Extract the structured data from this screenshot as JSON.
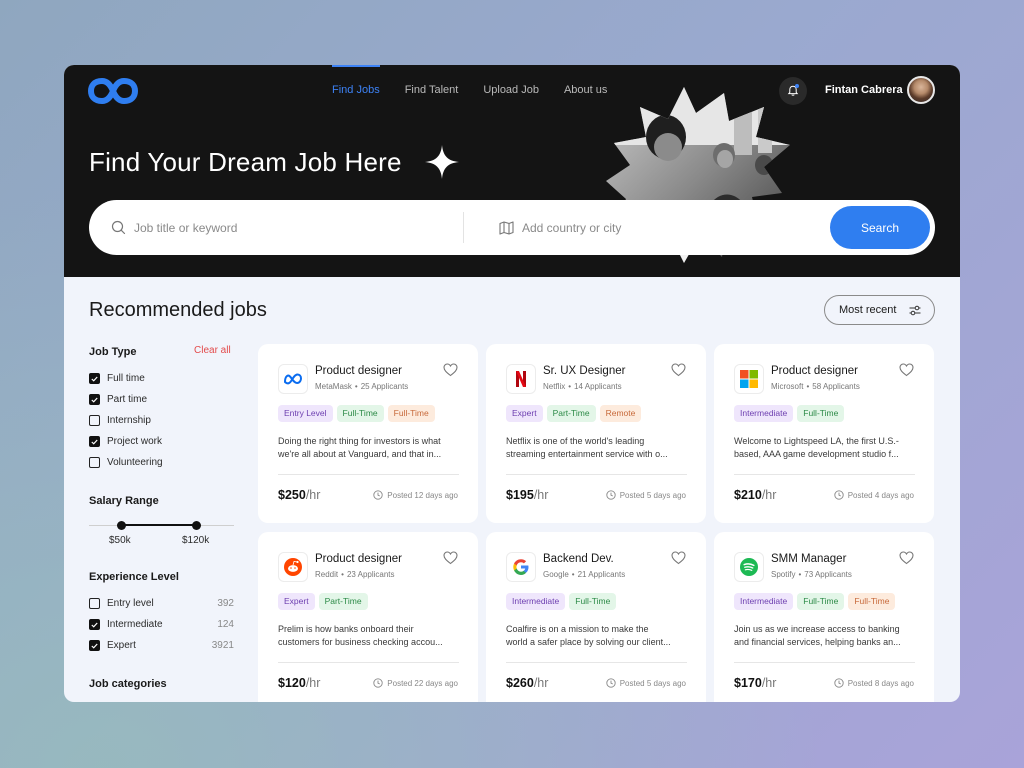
{
  "nav": {
    "items": [
      {
        "label": "Find Jobs",
        "active": true
      },
      {
        "label": "Find Talent",
        "active": false
      },
      {
        "label": "Upload Job",
        "active": false
      },
      {
        "label": "About us",
        "active": false
      }
    ],
    "user_name": "Fintan Cabrera"
  },
  "hero": {
    "title": "Find Your Dream Job Here",
    "search": {
      "keyword_placeholder": "Job title or keyword",
      "location_placeholder": "Add country or city",
      "button_label": "Search"
    }
  },
  "main": {
    "section_title": "Recommended jobs",
    "sort_label": "Most recent"
  },
  "filters": {
    "job_type": {
      "title": "Job Type",
      "clear_label": "Clear all",
      "options": [
        {
          "label": "Full time",
          "checked": true
        },
        {
          "label": "Part time",
          "checked": true
        },
        {
          "label": "Internship",
          "checked": false
        },
        {
          "label": "Project work",
          "checked": true
        },
        {
          "label": "Volunteering",
          "checked": false
        }
      ]
    },
    "salary": {
      "title": "Salary Range",
      "min_label": "$50k",
      "max_label": "$120k"
    },
    "experience": {
      "title": "Experience Level",
      "options": [
        {
          "label": "Entry level",
          "count": "392",
          "checked": false
        },
        {
          "label": "Intermediate",
          "count": "124",
          "checked": true
        },
        {
          "label": "Expert",
          "count": "3921",
          "checked": true
        }
      ]
    },
    "categories": {
      "title": "Job categories"
    }
  },
  "jobs": [
    {
      "title": "Product designer",
      "company": "MetaMask",
      "applicants": "25 Applicants",
      "logo": "meta-logo",
      "tags": [
        {
          "label": "Entry Level",
          "color": "purple"
        },
        {
          "label": "Full-Time",
          "color": "green"
        },
        {
          "label": "Full-Time",
          "color": "orange"
        }
      ],
      "desc1": "Doing the right thing for investors is what",
      "desc2": "we're all about at Vanguard, and that in...",
      "price": "$250",
      "unit": "/hr",
      "posted": "Posted 12 days ago"
    },
    {
      "title": "Sr. UX Designer",
      "company": "Netflix",
      "applicants": "14 Applicants",
      "logo": "netflix-logo",
      "tags": [
        {
          "label": "Expert",
          "color": "purple"
        },
        {
          "label": "Part-Time",
          "color": "green"
        },
        {
          "label": "Remote",
          "color": "orange"
        }
      ],
      "desc1": "Netflix is one of the world's leading",
      "desc2": "streaming entertainment service with o...",
      "price": "$195",
      "unit": "/hr",
      "posted": "Posted 5 days ago"
    },
    {
      "title": "Product designer",
      "company": "Microsoft",
      "applicants": "58 Applicants",
      "logo": "microsoft-logo",
      "tags": [
        {
          "label": "Intermediate",
          "color": "purple"
        },
        {
          "label": "Full-Time",
          "color": "green"
        }
      ],
      "desc1": "Welcome to Lightspeed LA, the first U.S.-",
      "desc2": "based, AAA game development studio f...",
      "price": "$210",
      "unit": "/hr",
      "posted": "Posted 4 days ago"
    },
    {
      "title": "Product designer",
      "company": "Reddit",
      "applicants": "23 Applicants",
      "logo": "reddit-logo",
      "tags": [
        {
          "label": "Expert",
          "color": "purple"
        },
        {
          "label": "Part-Time",
          "color": "green"
        }
      ],
      "desc1": "Prelim is how banks onboard their",
      "desc2": "customers for business checking accou...",
      "price": "$120",
      "unit": "/hr",
      "posted": "Posted 22 days ago"
    },
    {
      "title": "Backend Dev.",
      "company": "Google",
      "applicants": "21 Applicants",
      "logo": "google-logo",
      "tags": [
        {
          "label": "Intermediate",
          "color": "purple"
        },
        {
          "label": "Full-Time",
          "color": "green"
        }
      ],
      "desc1": "Coalfire is on a mission to make the",
      "desc2": "world a safer place by solving our client...",
      "price": "$260",
      "unit": "/hr",
      "posted": "Posted 5 days ago"
    },
    {
      "title": "SMM Manager",
      "company": "Spotify",
      "applicants": "73 Applicants",
      "logo": "spotify-logo",
      "tags": [
        {
          "label": "Intermediate",
          "color": "purple"
        },
        {
          "label": "Full-Time",
          "color": "green"
        },
        {
          "label": "Full-Time",
          "color": "orange"
        }
      ],
      "desc1": "Join us as we increase access to banking",
      "desc2": "and financial services, helping banks an...",
      "price": "$170",
      "unit": "/hr",
      "posted": "Posted 8 days ago"
    }
  ],
  "colors": {
    "accent": "#2f7ef0",
    "clear": "#e34b4b",
    "hero_bg": "#141414"
  }
}
